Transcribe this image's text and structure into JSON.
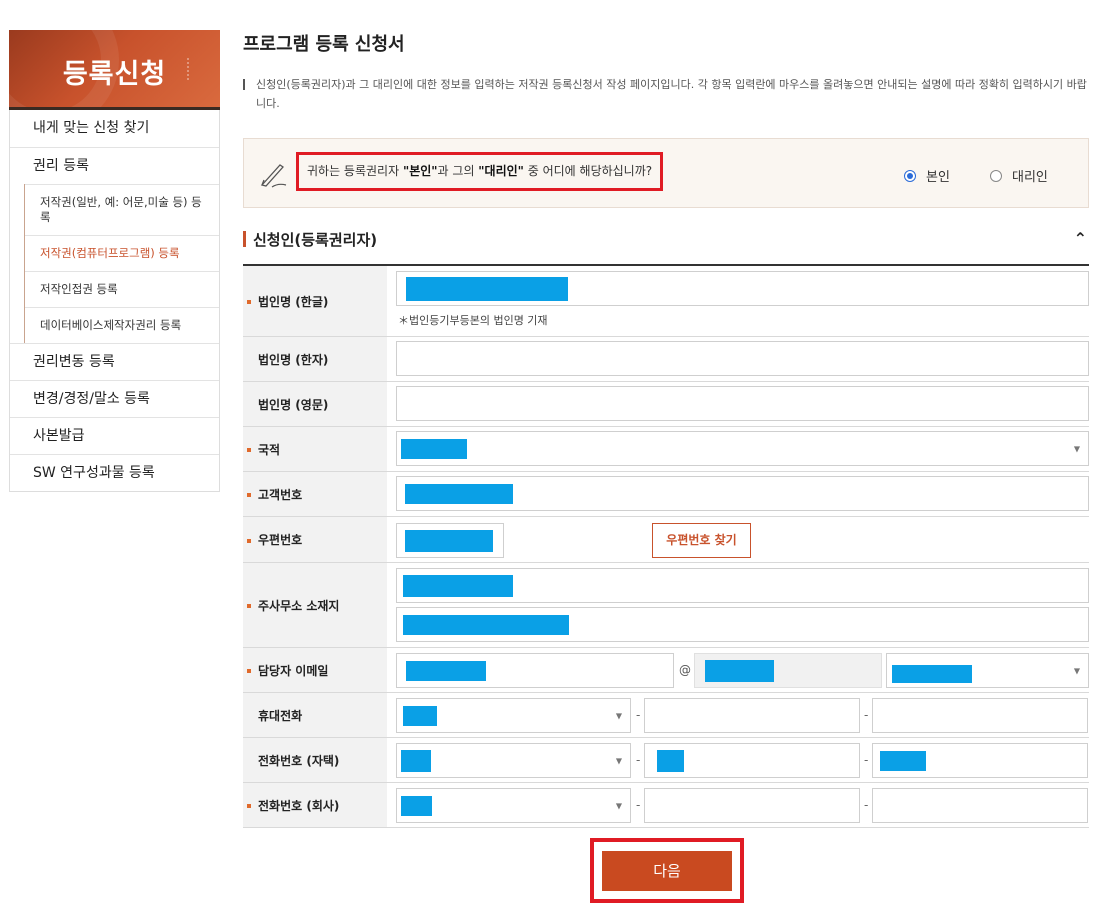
{
  "sidebar": {
    "banner_title": "등록신청",
    "items": [
      {
        "label": "내게 맞는 신청 찾기"
      },
      {
        "label": "권리 등록"
      },
      {
        "label": "권리변동 등록"
      },
      {
        "label": "변경/경정/말소 등록"
      },
      {
        "label": "사본발급"
      },
      {
        "label": "SW 연구성과물 등록"
      }
    ],
    "subitems": [
      {
        "label": "저작권(일반, 예: 어문,미술 등) 등록"
      },
      {
        "label": "저작권(컴퓨터프로그램) 등록"
      },
      {
        "label": "저작인접권 등록"
      },
      {
        "label": "데이터베이스제작자권리 등록"
      }
    ]
  },
  "page": {
    "title": "프로그램 등록 신청서",
    "description": "신청인(등록권리자)과 그 대리인에 대한 정보를 입력하는 저작권 등록신청서 작성 페이지입니다. 각 항목 입력란에 마우스를 올려놓으면 안내되는 설명에 따라 정확히 입력하시기 바랍니다."
  },
  "question": {
    "prefix": "귀하는 등록권리자 ",
    "opt1_quoted": "\"본인\"",
    "middle": "과 그의 ",
    "opt2_quoted": "\"대리인\"",
    "suffix": " 중 어디에 해당하십니까?",
    "radio_self": "본인",
    "radio_agent": "대리인",
    "selected": "본인"
  },
  "section": {
    "title": "신청인(등록권리자)"
  },
  "form": {
    "labels": {
      "corp_name_kor": "법인명 (한글)",
      "corp_name_hanja": "법인명 (한자)",
      "corp_name_eng": "법인명 (영문)",
      "nationality": "국적",
      "customer_no": "고객번호",
      "zipcode": "우편번호",
      "office_address": "주사무소 소재지",
      "contact_email": "담당자 이메일",
      "mobile": "휴대전화",
      "phone_home": "전화번호 (자택)",
      "phone_office": "전화번호 (회사)"
    },
    "corp_name_hint": "＊법인등기부등본의 법인명 기재",
    "zip_button": "우편번호 찾기",
    "email_at": "@",
    "dash": "-"
  },
  "actions": {
    "next": "다음"
  },
  "colors": {
    "accent": "#c8522c",
    "highlight": "#e01b24",
    "redacted": "#0aa0e6"
  }
}
